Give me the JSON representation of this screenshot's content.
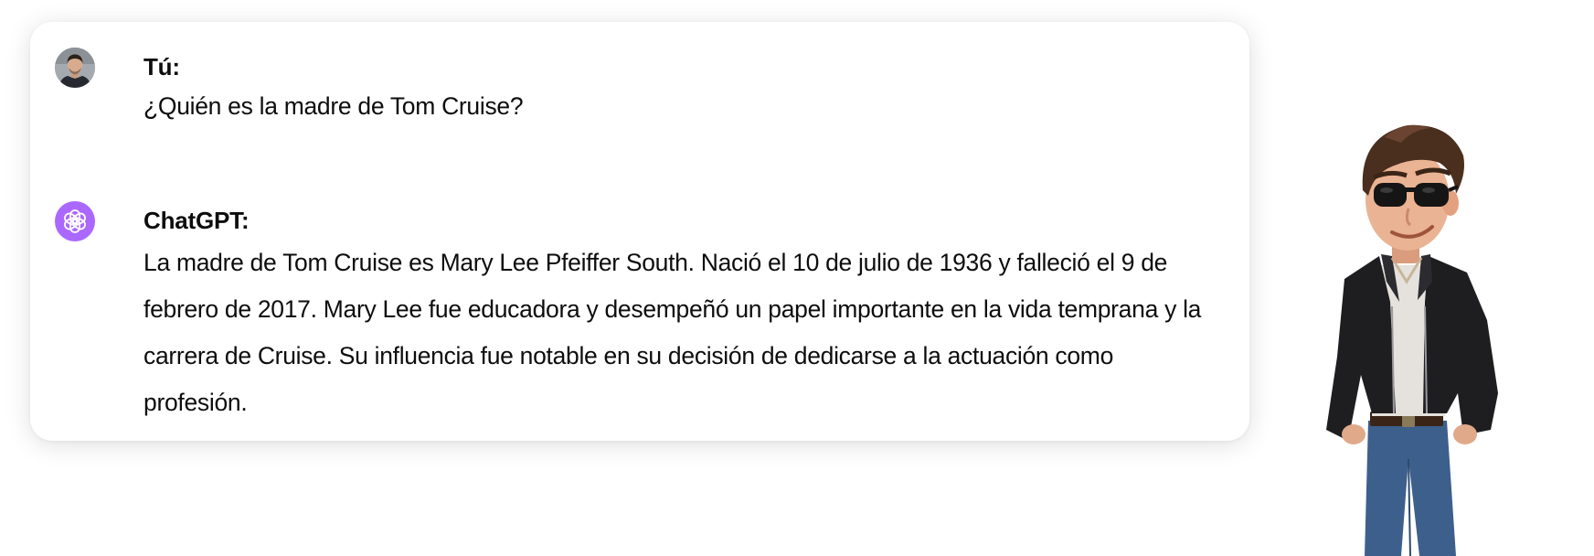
{
  "conversation": {
    "user": {
      "author": "Tú:",
      "text": "¿Quién es la madre de Tom Cruise?"
    },
    "assistant": {
      "author": "ChatGPT:",
      "text": "La madre de Tom Cruise es Mary Lee Pfeiffer South. Nació el 10 de julio de 1936 y falleció el 9 de febrero de 2017. Mary Lee fue educadora y desempeñó un papel importante en la vida temprana y la carrera de Cruise. Su influencia fue notable en su decisión de dedicarse a la actuación como profesión."
    }
  },
  "icons": {
    "user_avatar": "user-avatar-photo",
    "assistant_avatar": "openai-logo-icon",
    "illustration": "cartoon-character-sunglasses-leather-jacket"
  },
  "colors": {
    "assistant_avatar_bg": "#ab68ff",
    "card_bg": "#ffffff",
    "text": "#0d0d0d"
  }
}
